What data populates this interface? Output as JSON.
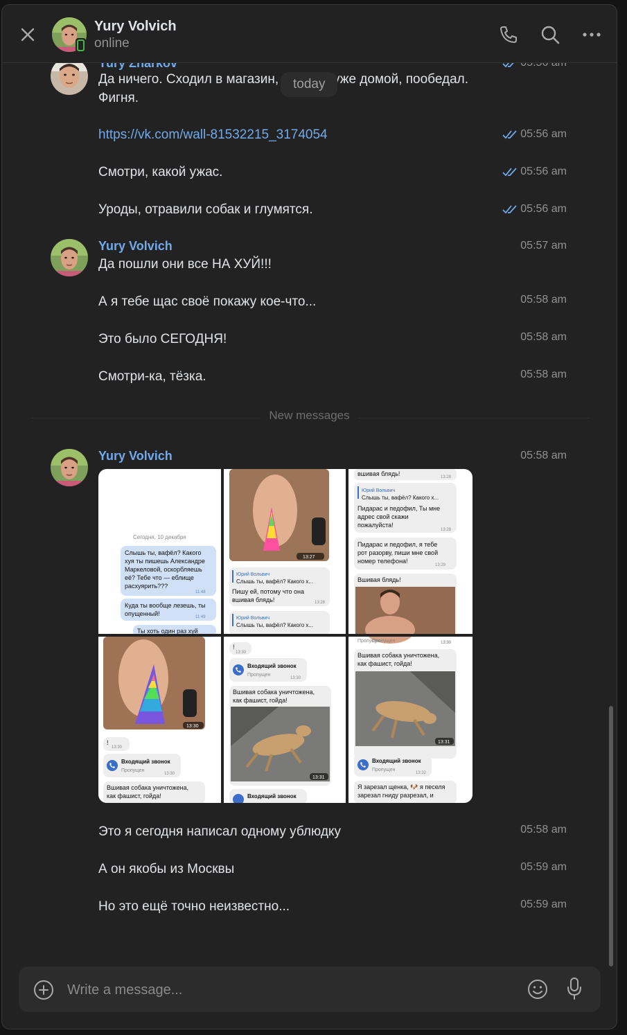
{
  "header": {
    "name": "Yury Volvich",
    "status": "online"
  },
  "date_badge": "today",
  "messages_top": [
    {
      "sender": "Yury Zharkov",
      "time": "05:56 am",
      "text": "Да ничего. Сходил в магазин, пришёл уже домой, пообедал. Фигня."
    },
    {
      "text": "https://vk.com/wall-81532215_3174054",
      "time": "05:56 am",
      "is_link": true
    },
    {
      "text": "Смотри, какой ужас.",
      "time": "05:56 am"
    },
    {
      "text": "Уроды, отравили собак и глумятся.",
      "time": "05:56 am"
    }
  ],
  "group2": {
    "sender": "Yury Volvich",
    "messages": [
      {
        "text": "Да пошли они все НА ХУЙ!!!",
        "time": "05:57 am"
      },
      {
        "text": "А я тебе щас своё покажу кое-что...",
        "time": "05:58 am"
      },
      {
        "text": "Это было СЕГОДНЯ!",
        "time": "05:58 am"
      },
      {
        "text": "Смотри-ка, тёзка.",
        "time": "05:58 am"
      }
    ]
  },
  "new_messages_label": "New messages",
  "group3": {
    "sender": "Yury Volvich",
    "photo_time": "05:58 am",
    "photo_texts": {
      "p1": [
        "Сегодня, 10 декабря",
        "Слышь ты, вафёл? Какого",
        "хуя ты пишешь Александре",
        "Маркеловой, оскорбляешь",
        "её? Тебе что — еблище",
        "расхуярить???",
        "11:48",
        "Куда ты вообще лезешь, ты",
        "опущенный!",
        "11:49",
        "Ты хоть один раз хуй"
      ],
      "p2": [
        "13:27",
        "Юрий Вольвич",
        "Слышь ты, вафёл? Какого х...",
        "Пишу ей, потому что она",
        "вшивая блядь!",
        "13:28",
        "Юрий Вольвич",
        "Слышь ты, вафёл? Какого х..."
      ],
      "p3": [
        "вшивая блядь!",
        "13:28",
        "Юрий Вольвич",
        "Слышь ты, вафёл? Какого х...",
        "Пидарас и педофил, Ты мне",
        "адрес свой скажи",
        "пожалуйста!",
        "13:28",
        "Пидарас и педофил, я тебе",
        "рот разорву, пиши мне свой",
        "номер телефона!",
        "13:29",
        "Вшивая блядь!",
        "Пропущен",
        "13:30"
      ],
      "p4": [
        "13:30",
        "!",
        "13:30",
        "Входящий звонок",
        "Пропущен",
        "13:30",
        "Вшивая собака уничтожена,",
        "как фашист, гойда!"
      ],
      "p5": [
        "!",
        "13:30",
        "Входящий звонок",
        "Пропущен",
        "13:30",
        "Вшивая собака уничтожена,",
        "как фашист, гойда!",
        "13:31",
        "Входящий звонок"
      ],
      "p6": [
        "Пропущен",
        "13:30",
        "Вшивая собака уничтожена,",
        "как фашист, гойда!",
        "13:31",
        "Входящий звонок",
        "Пропущен",
        "13:32",
        "Я зарезал щенка, 🐶 я песеля",
        "зарезал гниду разрезал, и"
      ]
    },
    "messages": [
      {
        "text": "Это я сегодня написал одному ублюдку",
        "time": "05:58 am"
      },
      {
        "text": "А он якобы из Москвы",
        "time": "05:59 am"
      },
      {
        "text": "Но это ещё точно неизвестно...",
        "time": "05:59 am"
      }
    ]
  },
  "composer": {
    "placeholder": "Write a message..."
  },
  "colors": {
    "background": "#222222",
    "accent": "#71aaeb",
    "online": "#4bb34b"
  },
  "icons": [
    "close-icon",
    "phone-icon",
    "search-icon",
    "more-icon",
    "add-attachment-icon",
    "smile-icon",
    "microphone-icon",
    "double-check-icon"
  ]
}
